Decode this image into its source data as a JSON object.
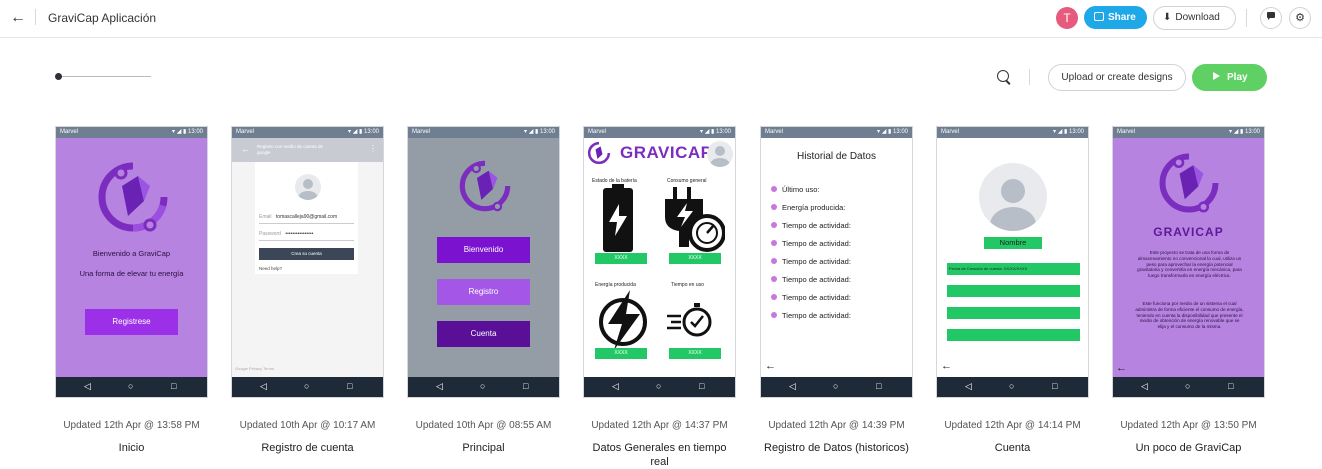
{
  "header": {
    "title": "GraviCap Aplicación",
    "avatar_letter": "T",
    "share_label": "Share",
    "download_label": "Download"
  },
  "toolbar": {
    "upload_label": "Upload or create designs",
    "play_label": "Play"
  },
  "status_bar": {
    "carrier": "Marvel",
    "time": "13:00"
  },
  "screens": [
    {
      "updated": "Updated 12th Apr @ 13:58 PM",
      "name": "Inicio",
      "welcome": "Bienvenido a GraviCap",
      "tagline": "Una forma de elevar tu energía",
      "button": "Registrese"
    },
    {
      "updated": "Updated 10th Apr @ 10:17 AM",
      "name": "Registro de cuenta",
      "header": "Registro con medio de cuenta de google",
      "email_label": "Email",
      "email_value": "tomascalleja90@gmail.com",
      "password_label": "Password",
      "password_value": "••••••••••••••••",
      "button": "Crea su cuenta",
      "help": "Need help?",
      "footer": "Google   Privacy   Terms"
    },
    {
      "updated": "Updated 10th Apr @ 08:55 AM",
      "name": "Principal",
      "buttons": [
        "Bienvenido",
        "Registro",
        "Cuenta"
      ]
    },
    {
      "updated": "Updated 12th Apr @ 14:37 PM",
      "name": "Datos Generales en tiempo real",
      "brand": "GRAVICAP",
      "labels": [
        "Estado de la batería",
        "Consumo general",
        "Energía producida",
        "Tiempo en uso"
      ],
      "value": "XXXX"
    },
    {
      "updated": "Updated 12th Apr @ 14:39 PM",
      "name": "Registro de Datos (historicos)",
      "title": "Historial de Datos",
      "rows": [
        "Último uso:",
        "Energía producida:",
        "Tiempo de actividad:",
        "Tiempo de actividad:",
        "Tiempo de actividad:",
        "Tiempo de actividad:",
        "Tiempo de actividad:",
        "Tiempo de actividad:"
      ]
    },
    {
      "updated": "Updated 12th Apr @ 14:14 PM",
      "name": "Cuenta",
      "user": "Nombre",
      "field": "Fecha de Creación de cuenta: XX/XX/XXXX"
    },
    {
      "updated": "Updated 12th Apr @ 13:50 PM",
      "name": "Un poco de GraviCap",
      "brand": "GRAVICAP",
      "para1": "Este proyecto se trata de una forma de almacenamiento no convencional la cual, utiliza un peso para aprovechar la energía potencial gravitatoria y convertirla en energía mecánica, para luego transformarla en energía eléctrica.",
      "para2": "Este funciona por medio de un sistema el cual administra de forma eficiente el consumo de energía, teniendo en cuenta la disponibilidad que presente el medio de obtención de energía renovable que se elija y el consumo de la misma."
    }
  ]
}
